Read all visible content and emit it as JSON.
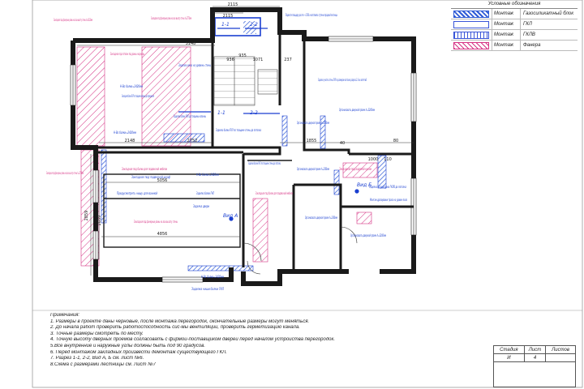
{
  "legend": {
    "title": "Условные обозначения",
    "rows": [
      {
        "action": "Монтаж",
        "material": "Газосиликатный блок",
        "color": "#2f5bd6"
      },
      {
        "action": "Монтаж",
        "material": "ГКЛ",
        "color": "#3a56d8"
      },
      {
        "action": "Монтаж",
        "material": "ГКЛВ",
        "color": "#3a56d8"
      },
      {
        "action": "Монтаж",
        "material": "Фанера",
        "color": "#d63384"
      }
    ]
  },
  "colors": {
    "wall": "#1a1a1a",
    "magenta": "#d63384",
    "blue": "#1a3fd0",
    "dim": "#333333"
  },
  "dimensions": [
    "2115",
    "2115",
    "3148",
    "2148",
    "2752",
    "1855",
    "80",
    "1000",
    "110",
    "5056",
    "4856",
    "2659",
    "2859",
    "237",
    "1071",
    "936",
    "935",
    "40"
  ],
  "cuts": [
    "1-1",
    "2-2",
    "1-1",
    "2-2"
  ],
  "view_labels": [
    "Вид А",
    "Вид Б"
  ],
  "plan_labels": {
    "magenta": [
      "Закладная под фанерные рамы на всю высоту стены h=4220мм",
      "Закладная под фанерные рамы на всю высоту стены h=2770мм",
      "Закладная под потолок под рамы и карнизы",
      "Закладная под фанерные рамы на всю высоту стены h=2770мм",
      "Закладная под балки для подвесной мебели",
      "Закладная под фанерные рамы на всю высоту стены",
      "Закладная под балки для подвесной мебели",
      "Закладная под водяной кухни"
    ],
    "blue": [
      "Подвести площадку до отм. +1.560 и изготовить ступени парадной лестницы",
      "Заделка окна на уровень стены",
      "Заделка участка стены ГКЛ по размерам согласно разреза 2-2 на листе №6",
      "Организовать дверной проем h=2200мм",
      "Организовать дверной проем h=2200мм",
      "Н-Во балки=2420мм",
      "Закладная балки ГКЛ по толщине колонны до перекрытия",
      "Н-Во балки=2420мм",
      "Заделка балки ГКЛ до толщины колонны",
      "Заделка балки ГКЛ по толщине стены до потолка",
      "Заделка балки ГКЛ по толщине стены до потолка",
      "Организовать дверной проем h=2200мм",
      "Закладная под подвесной шкаф",
      "Н-Во балки=2420мм",
      "Предусмотреть нишу для ванной",
      "Заделка балки ГКЛ",
      "Заделка двери",
      "Организовать дверной проем h=2200мм",
      "Заделка штукатурки ГКЛВ до потолка",
      "Монтаж драпировки трапа на уровне пола",
      "Организовать дверной проем h=2200мм",
      "Н-Во балки=2420мм",
      "Заделка ниши балки ГКЛ"
    ]
  },
  "notes": {
    "title": "Примечания:",
    "items": [
      "1. Размеры в проекте даны черновые, после монтажа перегородок, окончательные размеры могут меняться.",
      "2. До начала работ проверить работоспособность сис-мы вентиляции, проверить герметизацию канала.",
      "3. Точные размеры смотреть по месту.",
      "4. Точную высоту дверных проемов согласовать с фирмой-поставщиком дверей перед началом устройства перегородок.",
      "5.Все внутренние и наружные углы должны быть под 90 градусов.",
      "6. Перед монтажом закладных произвести демонтаж существующего ГКЛ.",
      "7. Разрез 1-1, 2-2, Вид А, Б см. лист №6.",
      "8.Схема с размерами лестницы см. Лист №7"
    ]
  },
  "stamp": {
    "headers": [
      "Стадия",
      "Лист",
      "Листов"
    ],
    "stage": "И",
    "sheet": "4",
    "sheets": ""
  }
}
